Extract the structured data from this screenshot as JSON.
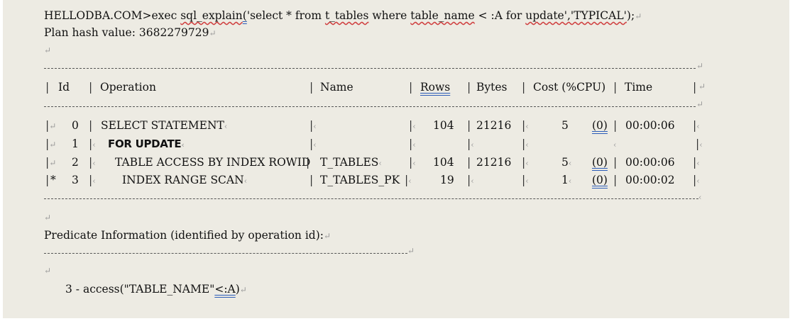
{
  "command": {
    "prefix": "HELLODBA.COM>exec ",
    "func": "sql_explain",
    "paren": "(",
    "q1": "'select * from ",
    "tbl": "t_tables",
    "q2": " where ",
    "col": "table_name",
    "q3": " < :A for ",
    "upd": "update','TYPICAL'",
    "end": ");"
  },
  "plan_hash": "Plan hash value: 3682279729",
  "table": {
    "headers": {
      "id": "Id",
      "operation": "Operation",
      "name": "Name",
      "rows": "Rows",
      "bytes": "Bytes",
      "cost": "Cost (%CPU)",
      "time": "Time"
    },
    "rows": [
      {
        "marker": "",
        "id": "0",
        "operation": "SELECT STATEMENT",
        "name": "",
        "rows": "104",
        "bytes": "21216",
        "cost": "5",
        "cpu": "(0)",
        "time": "00:00:06"
      },
      {
        "marker": "",
        "id": "1",
        "operation": "FOR UPDATE",
        "name": "",
        "rows": "",
        "bytes": "",
        "cost": "",
        "cpu": "",
        "time": ""
      },
      {
        "marker": "",
        "id": "2",
        "operation": "TABLE ACCESS BY INDEX ROWID",
        "name": "T_TABLES",
        "rows": "104",
        "bytes": "21216",
        "cost": "5",
        "cpu": "(0)",
        "time": "00:00:06"
      },
      {
        "marker": "*",
        "id": "3",
        "operation": "INDEX RANGE SCAN",
        "name": "T_TABLES_PK",
        "rows": "19",
        "bytes": "",
        "cost": "1",
        "cpu": "(0)",
        "time": "00:00:02"
      }
    ]
  },
  "predicate": {
    "heading": "Predicate Information (identified by operation id):",
    "line_prefix": "3 - access(\"TABLE_NAME\"",
    "line_op": "<:A",
    "line_end": ")"
  }
}
